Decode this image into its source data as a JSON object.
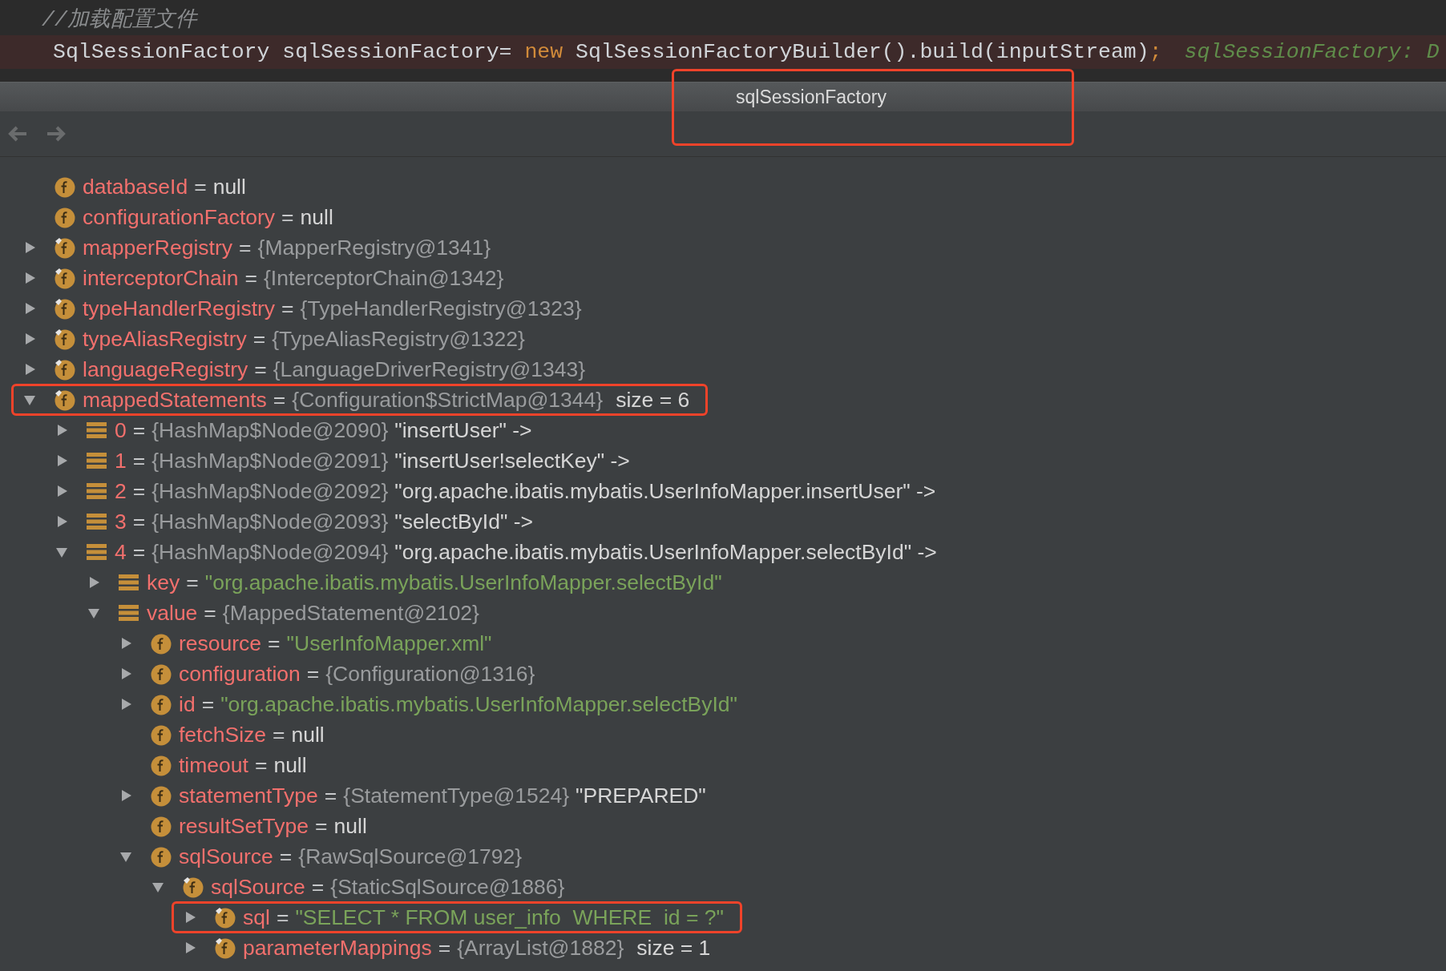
{
  "editor": {
    "lines": [
      {
        "highlighted": false,
        "tokens": [
          {
            "kind": "comment",
            "text": "//加载配置文件"
          }
        ]
      },
      {
        "highlighted": true,
        "tokens": [
          {
            "kind": "plain",
            "text": "SqlSessionFactory sqlSessionFactory= "
          },
          {
            "kind": "keyword",
            "text": "new"
          },
          {
            "kind": "plain",
            "text": " SqlSessionFactoryBuilder().build(inputStream)"
          },
          {
            "kind": "keyword",
            "text": ";"
          },
          {
            "kind": "hint",
            "text": "sqlSessionFactory: D"
          }
        ]
      }
    ]
  },
  "popup": {
    "title": "sqlSessionFactory",
    "title_highlighted": true,
    "toolbar": [
      {
        "kind": "back",
        "disabled": true
      },
      {
        "kind": "forward",
        "disabled": true
      }
    ],
    "tree": [
      {
        "name": "databaseId",
        "kind": "field",
        "highlighted": false,
        "parts": [
          {
            "kind": "op",
            "text": "="
          },
          {
            "kind": "literal",
            "text": "null"
          }
        ]
      },
      {
        "name": "configurationFactory",
        "kind": "field",
        "highlighted": false,
        "parts": [
          {
            "kind": "op",
            "text": "="
          },
          {
            "kind": "literal",
            "text": "null"
          }
        ]
      },
      {
        "name": "mapperRegistry",
        "kind": "final",
        "expanded": false,
        "highlighted": false,
        "parts": [
          {
            "kind": "op",
            "text": "="
          },
          {
            "kind": "ref",
            "text": "{MapperRegistry@1341}"
          }
        ]
      },
      {
        "name": "interceptorChain",
        "kind": "final",
        "expanded": false,
        "highlighted": false,
        "parts": [
          {
            "kind": "op",
            "text": "="
          },
          {
            "kind": "ref",
            "text": "{InterceptorChain@1342}"
          }
        ]
      },
      {
        "name": "typeHandlerRegistry",
        "kind": "final",
        "expanded": false,
        "highlighted": false,
        "parts": [
          {
            "kind": "op",
            "text": "="
          },
          {
            "kind": "ref",
            "text": "{TypeHandlerRegistry@1323}"
          }
        ]
      },
      {
        "name": "typeAliasRegistry",
        "kind": "final",
        "expanded": false,
        "highlighted": false,
        "parts": [
          {
            "kind": "op",
            "text": "="
          },
          {
            "kind": "ref",
            "text": "{TypeAliasRegistry@1322}"
          }
        ]
      },
      {
        "name": "languageRegistry",
        "kind": "final",
        "expanded": false,
        "highlighted": false,
        "parts": [
          {
            "kind": "op",
            "text": "="
          },
          {
            "kind": "ref",
            "text": "{LanguageDriverRegistry@1343}"
          }
        ]
      },
      {
        "name": "mappedStatements",
        "kind": "final",
        "expanded": true,
        "highlighted": true,
        "parts": [
          {
            "kind": "op",
            "text": "="
          },
          {
            "kind": "ref",
            "text": "{Configuration$StrictMap@1344}"
          },
          {
            "kind": "size",
            "text": "size = 6"
          }
        ],
        "children": [
          {
            "name": "0",
            "kind": "entry",
            "expanded": false,
            "highlighted": false,
            "parts": [
              {
                "kind": "op",
                "text": "="
              },
              {
                "kind": "ref",
                "text": "{HashMap$Node@2090}"
              },
              {
                "kind": "literal",
                "text": "\"insertUser\" ->"
              }
            ]
          },
          {
            "name": "1",
            "kind": "entry",
            "expanded": false,
            "highlighted": false,
            "parts": [
              {
                "kind": "op",
                "text": "="
              },
              {
                "kind": "ref",
                "text": "{HashMap$Node@2091}"
              },
              {
                "kind": "literal",
                "text": "\"insertUser!selectKey\" ->"
              }
            ]
          },
          {
            "name": "2",
            "kind": "entry",
            "expanded": false,
            "highlighted": false,
            "parts": [
              {
                "kind": "op",
                "text": "="
              },
              {
                "kind": "ref",
                "text": "{HashMap$Node@2092}"
              },
              {
                "kind": "literal",
                "text": "\"org.apache.ibatis.mybatis.UserInfoMapper.insertUser\" ->"
              }
            ]
          },
          {
            "name": "3",
            "kind": "entry",
            "expanded": false,
            "highlighted": false,
            "parts": [
              {
                "kind": "op",
                "text": "="
              },
              {
                "kind": "ref",
                "text": "{HashMap$Node@2093}"
              },
              {
                "kind": "literal",
                "text": "\"selectById\" ->"
              }
            ]
          },
          {
            "name": "4",
            "kind": "entry",
            "expanded": true,
            "highlighted": false,
            "parts": [
              {
                "kind": "op",
                "text": "="
              },
              {
                "kind": "ref",
                "text": "{HashMap$Node@2094}"
              },
              {
                "kind": "literal",
                "text": "\"org.apache.ibatis.mybatis.UserInfoMapper.selectById\" ->"
              }
            ],
            "children": [
              {
                "name": "key",
                "kind": "entry",
                "expanded": false,
                "highlighted": false,
                "parts": [
                  {
                    "kind": "op",
                    "text": "="
                  },
                  {
                    "kind": "string",
                    "text": "\"org.apache.ibatis.mybatis.UserInfoMapper.selectById\""
                  }
                ]
              },
              {
                "name": "value",
                "kind": "entry",
                "expanded": true,
                "highlighted": false,
                "parts": [
                  {
                    "kind": "op",
                    "text": "="
                  },
                  {
                    "kind": "ref",
                    "text": "{MappedStatement@2102}"
                  }
                ],
                "children": [
                  {
                    "name": "resource",
                    "kind": "field",
                    "expanded": false,
                    "highlighted": false,
                    "parts": [
                      {
                        "kind": "op",
                        "text": "="
                      },
                      {
                        "kind": "string",
                        "text": "\"UserInfoMapper.xml\""
                      }
                    ]
                  },
                  {
                    "name": "configuration",
                    "kind": "field",
                    "expanded": false,
                    "highlighted": false,
                    "parts": [
                      {
                        "kind": "op",
                        "text": "="
                      },
                      {
                        "kind": "ref",
                        "text": "{Configuration@1316}"
                      }
                    ]
                  },
                  {
                    "name": "id",
                    "kind": "field",
                    "expanded": false,
                    "highlighted": false,
                    "parts": [
                      {
                        "kind": "op",
                        "text": "="
                      },
                      {
                        "kind": "string",
                        "text": "\"org.apache.ibatis.mybatis.UserInfoMapper.selectById\""
                      }
                    ]
                  },
                  {
                    "name": "fetchSize",
                    "kind": "field",
                    "highlighted": false,
                    "parts": [
                      {
                        "kind": "op",
                        "text": "="
                      },
                      {
                        "kind": "literal",
                        "text": "null"
                      }
                    ]
                  },
                  {
                    "name": "timeout",
                    "kind": "field",
                    "highlighted": false,
                    "parts": [
                      {
                        "kind": "op",
                        "text": "="
                      },
                      {
                        "kind": "literal",
                        "text": "null"
                      }
                    ]
                  },
                  {
                    "name": "statementType",
                    "kind": "field",
                    "expanded": false,
                    "highlighted": false,
                    "parts": [
                      {
                        "kind": "op",
                        "text": "="
                      },
                      {
                        "kind": "ref",
                        "text": "{StatementType@1524}"
                      },
                      {
                        "kind": "literal",
                        "text": "\"PREPARED\""
                      }
                    ]
                  },
                  {
                    "name": "resultSetType",
                    "kind": "field",
                    "highlighted": false,
                    "parts": [
                      {
                        "kind": "op",
                        "text": "="
                      },
                      {
                        "kind": "literal",
                        "text": "null"
                      }
                    ]
                  },
                  {
                    "name": "sqlSource",
                    "kind": "field",
                    "expanded": true,
                    "highlighted": false,
                    "parts": [
                      {
                        "kind": "op",
                        "text": "="
                      },
                      {
                        "kind": "ref",
                        "text": "{RawSqlSource@1792}"
                      }
                    ],
                    "children": [
                      {
                        "name": "sqlSource",
                        "kind": "final",
                        "expanded": true,
                        "highlighted": false,
                        "parts": [
                          {
                            "kind": "op",
                            "text": "="
                          },
                          {
                            "kind": "ref",
                            "text": "{StaticSqlSource@1886}"
                          }
                        ],
                        "children": [
                          {
                            "name": "sql",
                            "kind": "final",
                            "expanded": false,
                            "highlighted": true,
                            "parts": [
                              {
                                "kind": "op",
                                "text": "="
                              },
                              {
                                "kind": "string",
                                "text": "\"SELECT * FROM user_info  WHERE  id = ?\""
                              }
                            ]
                          },
                          {
                            "name": "parameterMappings",
                            "kind": "final",
                            "expanded": false,
                            "highlighted": false,
                            "parts": [
                              {
                                "kind": "op",
                                "text": "="
                              },
                              {
                                "kind": "ref",
                                "text": "{ArrayList@1882}"
                              },
                              {
                                "kind": "size",
                                "text": "size = 1"
                              }
                            ]
                          }
                        ]
                      }
                    ]
                  }
                ]
              }
            ]
          }
        ]
      }
    ]
  }
}
